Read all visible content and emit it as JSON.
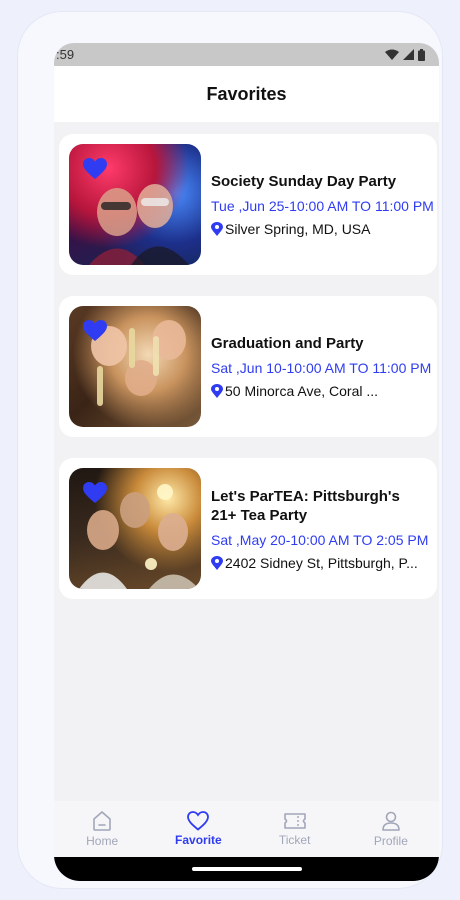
{
  "status_bar": {
    "time": ":59"
  },
  "header": {
    "title": "Favorites"
  },
  "events": [
    {
      "title": "Society Sunday Day Party",
      "date": "Tue ,Jun 25-10:00 AM TO 11:00 PM",
      "location": "Silver Spring, MD, USA"
    },
    {
      "title": "Graduation and Party",
      "date": "Sat ,Jun 10-10:00 AM TO 11:00 PM",
      "location": "50 Minorca Ave, Coral ..."
    },
    {
      "title": "Let's ParTEA: Pittsburgh's 21+ Tea Party",
      "date": "Sat ,May 20-10:00 AM TO 2:05 PM",
      "location": "2402 Sidney St, Pittsburgh, P..."
    }
  ],
  "nav": {
    "home": "Home",
    "favorite": "Favorite",
    "ticket": "Ticket",
    "profile": "Profile"
  },
  "colors": {
    "accent": "#2f3cf2",
    "inactive": "#a1a6b8"
  }
}
